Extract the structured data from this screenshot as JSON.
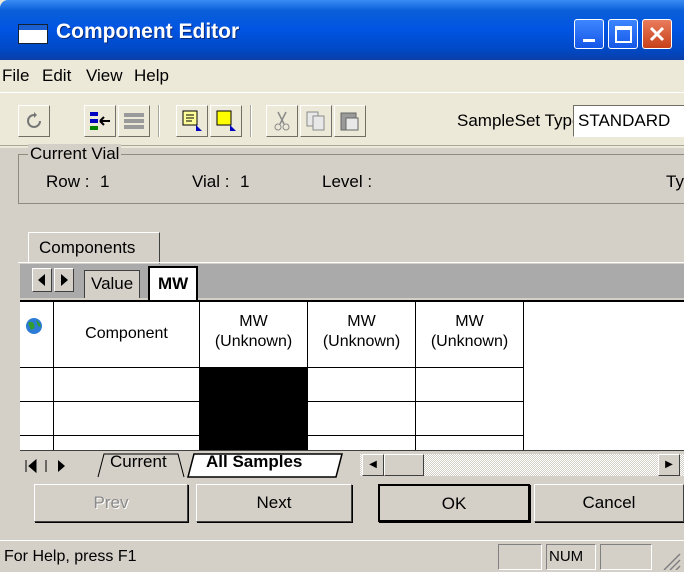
{
  "window": {
    "title": "Component Editor"
  },
  "menu": [
    "File",
    "Edit",
    "View",
    "Help"
  ],
  "toolbar": {
    "icons": [
      "refresh-icon",
      "insert-row-icon",
      "delete-row-icon",
      "copy-down-icon",
      "fill-down-icon",
      "cut-icon",
      "copy-icon",
      "paste-icon"
    ],
    "sampleset_type_label": "SampleSet Type:",
    "sampleset_type_value": "STANDARD"
  },
  "current_vial": {
    "title": "Current Vial",
    "row_label": "Row :",
    "row_value": "1",
    "vial_label": "Vial :",
    "vial_value": "1",
    "level_label": "Level :",
    "type_label": "Ty"
  },
  "tabs": {
    "components": "Components"
  },
  "grid_tabs": {
    "value": "Value",
    "mw": "MW",
    "active": "MW"
  },
  "grid": {
    "headers": [
      {
        "top": "",
        "bottom": "Component"
      },
      {
        "top": "MW",
        "bottom": "(Unknown)"
      },
      {
        "top": "MW",
        "bottom": "(Unknown)"
      },
      {
        "top": "MW",
        "bottom": "(Unknown)"
      }
    ]
  },
  "sheet_tabs": {
    "current": "Current",
    "all_samples": "All Samples",
    "active": "All Samples"
  },
  "buttons": {
    "prev": "Prev",
    "next": "Next",
    "ok": "OK",
    "cancel": "Cancel"
  },
  "status": {
    "help": "For Help, press F1",
    "num": "NUM"
  },
  "colors": {
    "titlebar": "#0054e3",
    "close_button": "#c7401a",
    "grid_selection": "#000000"
  }
}
